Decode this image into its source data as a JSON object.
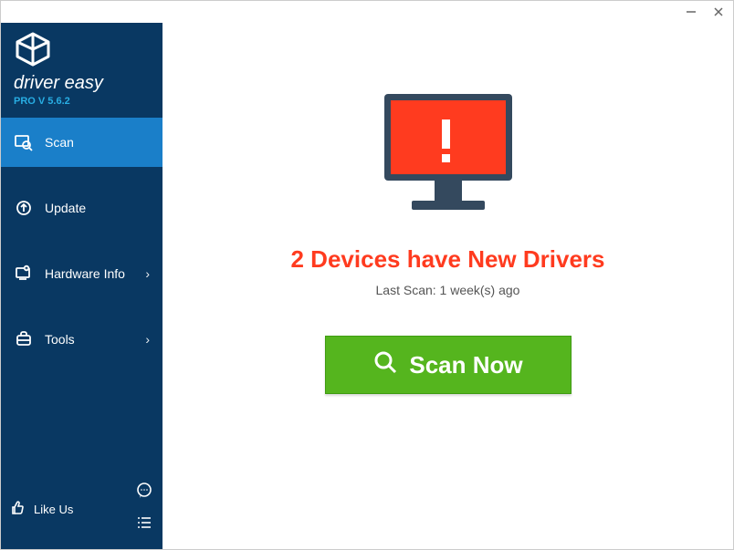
{
  "brand": {
    "name": "driver easy",
    "version_label": "PRO V 5.6.2"
  },
  "sidebar": {
    "items": [
      {
        "label": "Scan",
        "icon": "scan-icon",
        "active": true,
        "chevron": false
      },
      {
        "label": "Update",
        "icon": "update-icon",
        "active": false,
        "chevron": false
      },
      {
        "label": "Hardware Info",
        "icon": "hardware-icon",
        "active": false,
        "chevron": true
      },
      {
        "label": "Tools",
        "icon": "tools-icon",
        "active": false,
        "chevron": true
      }
    ],
    "like_label": "Like Us"
  },
  "content": {
    "alert_count": 2,
    "status_text": "2 Devices have New Drivers",
    "last_scan_text": "Last Scan: 1 week(s) ago",
    "scan_button_label": "Scan Now",
    "colors": {
      "alert": "#ff3b1f",
      "button_bg": "#55b51e",
      "button_border": "#3f9c11"
    }
  },
  "icons": {
    "chevron_right": "›"
  }
}
